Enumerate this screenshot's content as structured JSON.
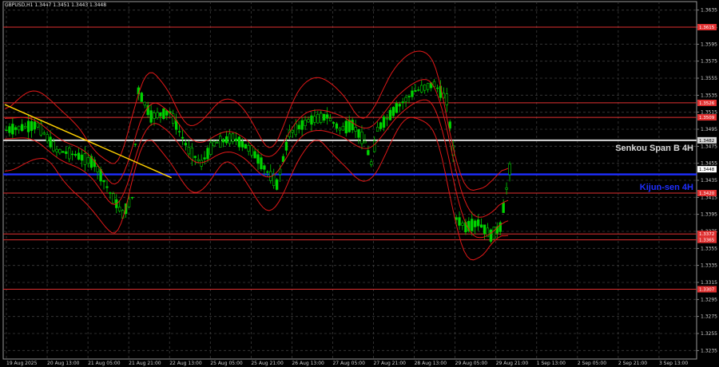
{
  "chart_data": {
    "type": "candlestick",
    "symbol_header": "GBPUSD,H1  1.3447 1.3451 1.3443 1.3448",
    "x_tick_labels": [
      "19 Aug 2025",
      "20 Aug 13:00",
      "21 Aug 05:00",
      "21 Aug 21:00",
      "22 Aug 13:00",
      "25 Aug 05:00",
      "25 Aug 21:00",
      "26 Aug 13:00",
      "27 Aug 05:00",
      "27 Aug 21:00",
      "28 Aug 13:00",
      "29 Aug 05:00",
      "29 Aug 21:00",
      "1 Sep 13:00",
      "2 Sep 05:00",
      "2 Sep 21:00",
      "3 Sep 13:00"
    ],
    "y_tick_labels": [
      "1.3635",
      "1.3615",
      "1.3595",
      "1.3575",
      "1.3555",
      "1.3535",
      "1.3515",
      "1.3495",
      "1.3475",
      "1.3455",
      "1.3435",
      "1.3415",
      "1.3395",
      "1.3375",
      "1.3355",
      "1.3335",
      "1.3315",
      "1.3295",
      "1.3275",
      "1.3255",
      "1.3235"
    ],
    "ylim": [
      1.3225,
      1.3645
    ],
    "current_price": "1.3448",
    "horizontal_levels": [
      {
        "price": 1.3615,
        "label": "1.3615",
        "color": "#e03030"
      },
      {
        "price": 1.3526,
        "label": "1.3526",
        "color": "#e03030"
      },
      {
        "price": 1.3509,
        "label": "1.3509",
        "color": "#e03030"
      },
      {
        "price": 1.3482,
        "label": "1.3482",
        "color": "#d8d8d8"
      },
      {
        "price": 1.3442,
        "label": "",
        "color": "#1e2eff"
      },
      {
        "price": 1.342,
        "label": "1.3420",
        "color": "#e03030"
      },
      {
        "price": 1.3372,
        "label": "1.3372",
        "color": "#e03030"
      },
      {
        "price": 1.3365,
        "label": "1.3365",
        "color": "#e03030"
      },
      {
        "price": 1.3307,
        "label": "1.3307",
        "color": "#e03030"
      }
    ],
    "annotations": [
      {
        "text": "Senkou Span B 4H",
        "price": 1.3482,
        "color": "#d8d8d8"
      },
      {
        "text": "Kijun-sen 4H",
        "price": 1.3436,
        "color": "#1e2eff"
      }
    ],
    "trendline": {
      "from": {
        "bar": 0,
        "price": 1.3524
      },
      "to": {
        "bar": 53,
        "price": 1.3438
      },
      "color": "#ffd000"
    },
    "candle_color": "#00d400"
  }
}
